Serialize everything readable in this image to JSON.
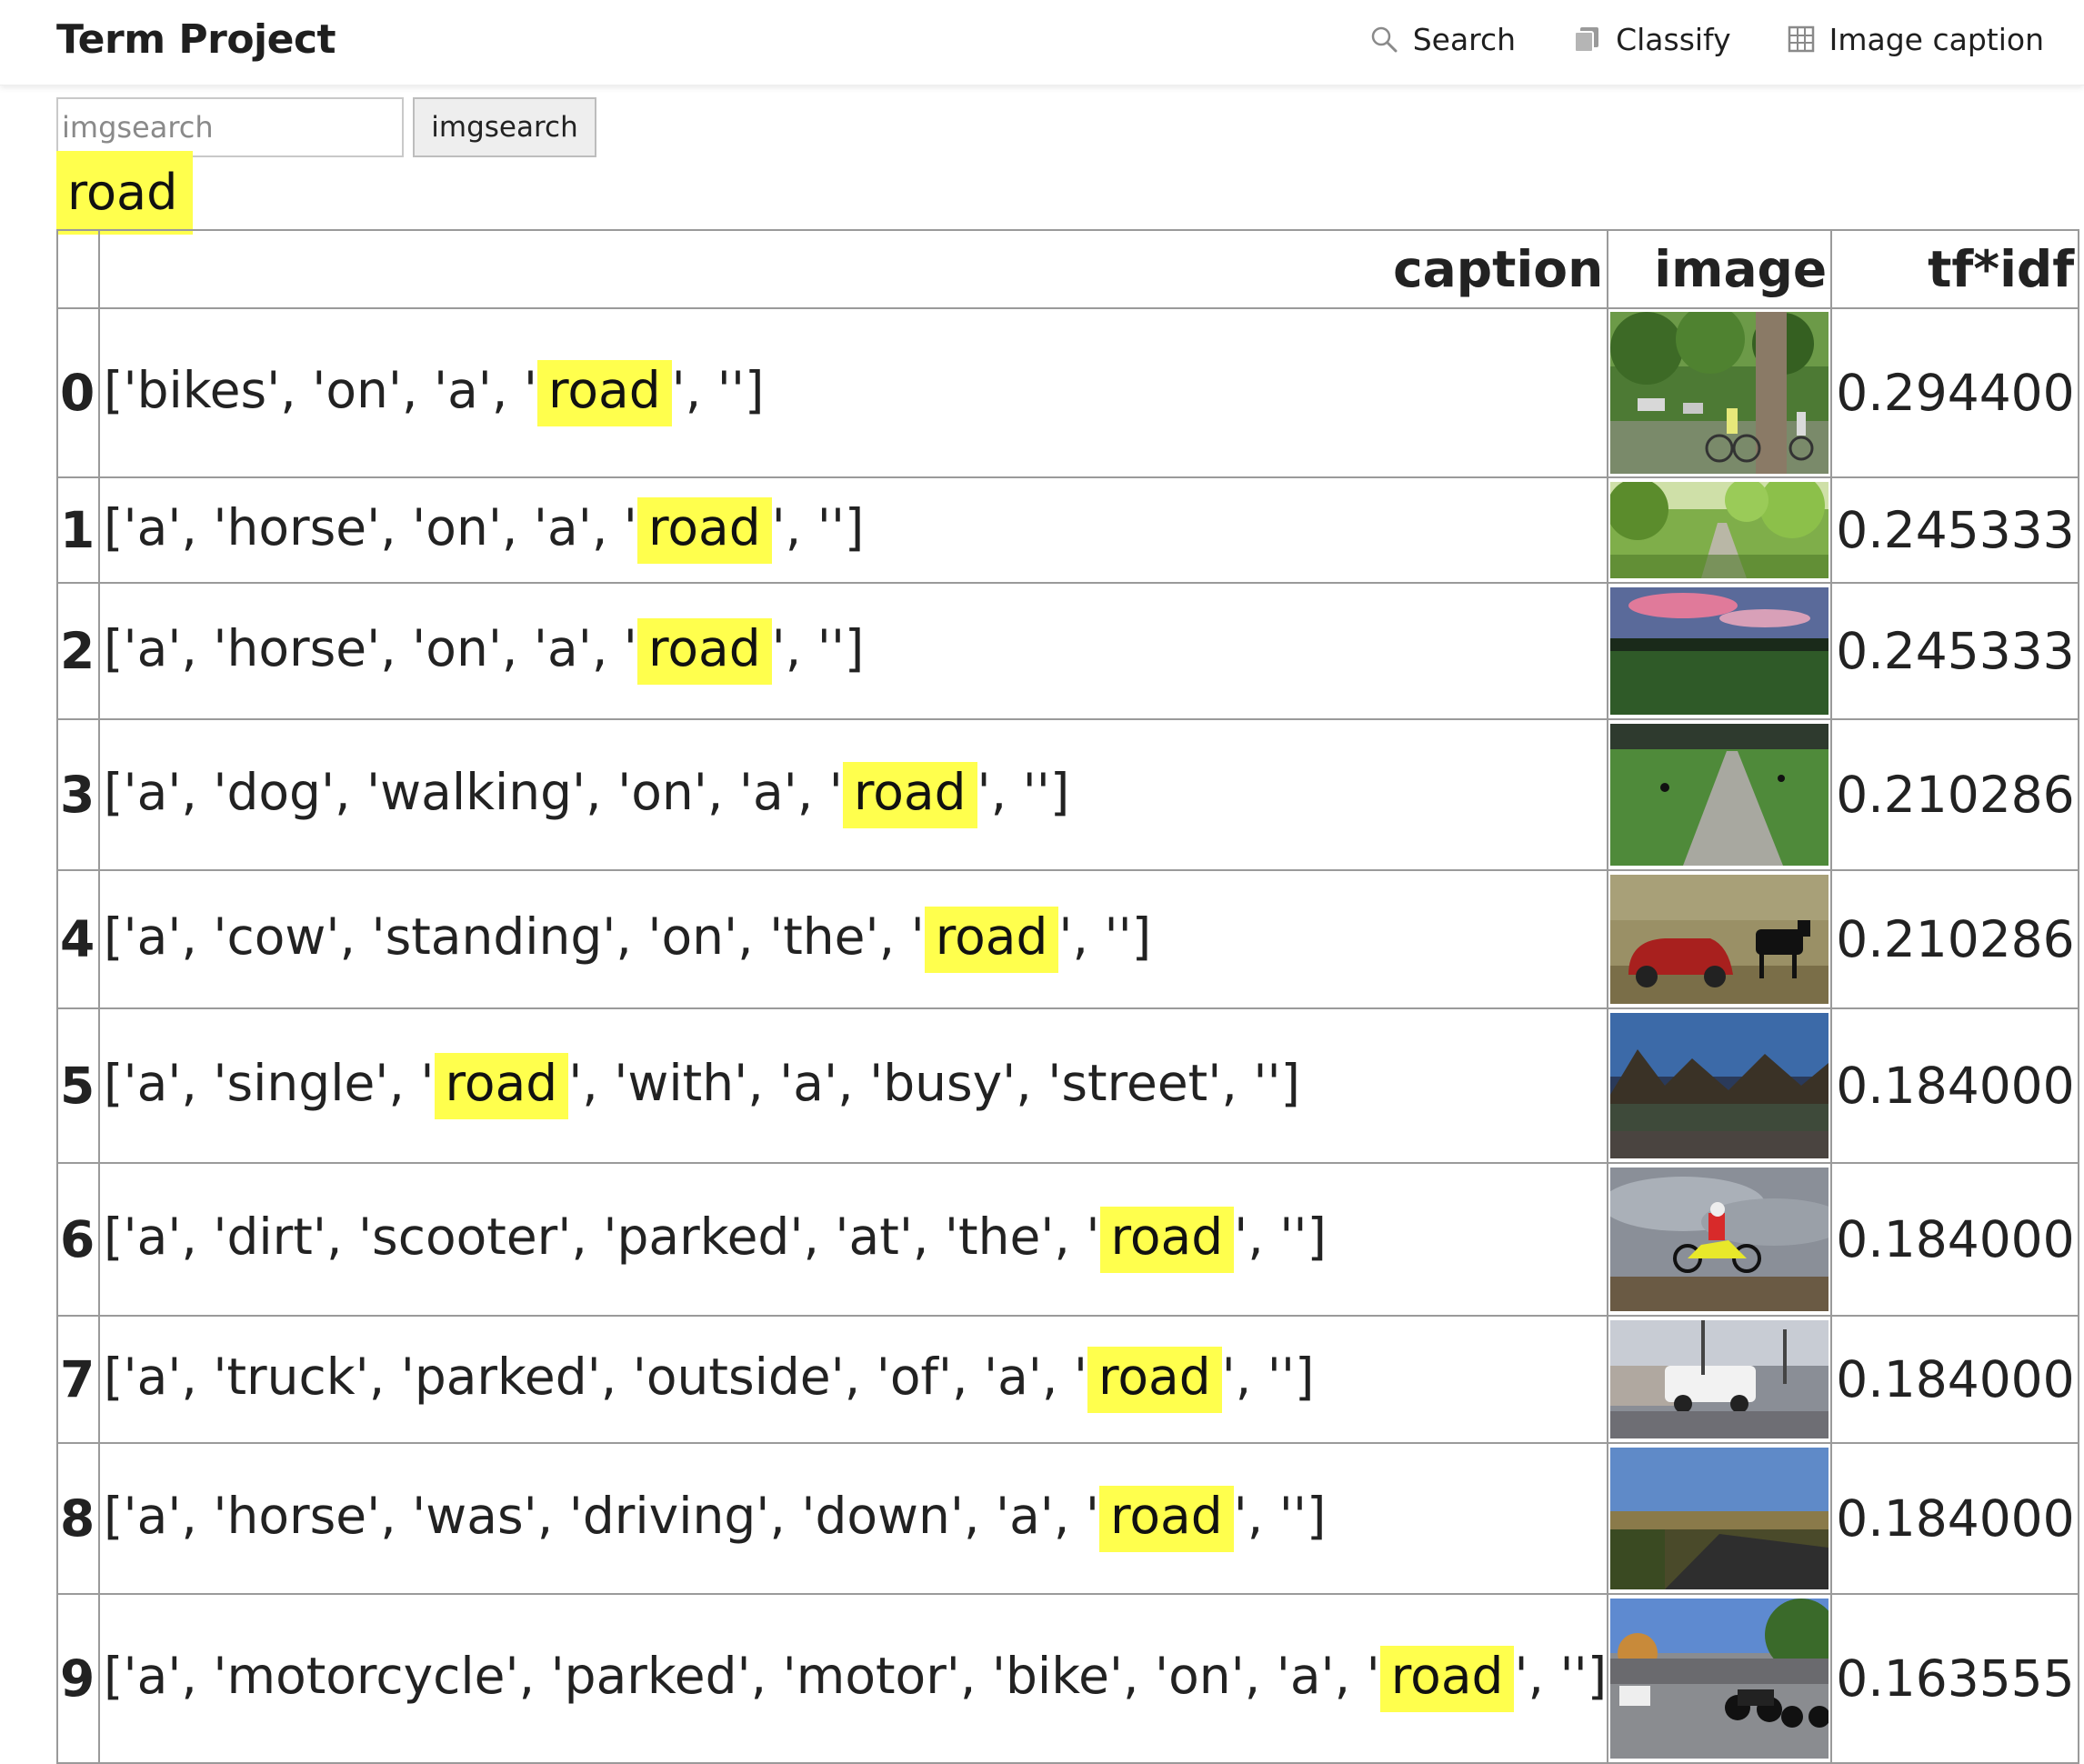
{
  "header": {
    "title": "Term Project",
    "nav": [
      {
        "label": "Search",
        "icon": "search-icon"
      },
      {
        "label": "Classify",
        "icon": "copy-icon"
      },
      {
        "label": "Image caption",
        "icon": "grid-icon"
      }
    ]
  },
  "search": {
    "placeholder": "imgsearch",
    "value": "",
    "button_label": "imgsearch"
  },
  "query": "road",
  "colors": {
    "highlight": "#ffff4d",
    "border": "#9a9a9a"
  },
  "table": {
    "columns": [
      "",
      "caption",
      "image",
      "tf*idf"
    ],
    "rows": [
      {
        "index": "0",
        "pre": "['bikes', 'on', 'a', '",
        "term": "road",
        "post": "', '']",
        "score": "0.294400",
        "image": "park cyclists photo"
      },
      {
        "index": "1",
        "pre": "['a', 'horse', 'on', 'a', '",
        "term": "road",
        "post": "', '']",
        "score": "0.245333",
        "image": "tree-lined road photo"
      },
      {
        "index": "2",
        "pre": "['a', 'horse', 'on', 'a', '",
        "term": "road",
        "post": "', '']",
        "score": "0.245333",
        "image": "field at dusk photo"
      },
      {
        "index": "3",
        "pre": "['a', 'dog', 'walking', 'on', 'a', '",
        "term": "road",
        "post": "', '']",
        "score": "0.210286",
        "image": "dog on path photo"
      },
      {
        "index": "4",
        "pre": "['a', 'cow', 'standing', 'on', 'the', '",
        "term": "road",
        "post": "', '']",
        "score": "0.210286",
        "image": "red car and cow photo"
      },
      {
        "index": "5",
        "pre": "['a', 'single', '",
        "term": "road",
        "post": "', 'with', 'a', 'busy', 'street', '']",
        "score": "0.184000",
        "image": "street with trees photo"
      },
      {
        "index": "6",
        "pre": "['a', 'dirt', 'scooter', 'parked', 'at', 'the', '",
        "term": "road",
        "post": "', '']",
        "score": "0.184000",
        "image": "dirt bike jump photo"
      },
      {
        "index": "7",
        "pre": "['a', 'truck', 'parked', 'outside', 'of', 'a', '",
        "term": "road",
        "post": "', '']",
        "score": "0.184000",
        "image": "white truck at roadside photo"
      },
      {
        "index": "8",
        "pre": "['a', 'horse', 'was', 'driving', 'down', 'a', '",
        "term": "road",
        "post": "', '']",
        "score": "0.184000",
        "image": "rural road at sunset photo"
      },
      {
        "index": "9",
        "pre": "['a', 'motorcycle', 'parked', 'motor', 'bike', 'on', 'a', '",
        "term": "road",
        "post": "', '']",
        "score": "0.163555",
        "image": "motorcycles on street photo"
      }
    ]
  }
}
